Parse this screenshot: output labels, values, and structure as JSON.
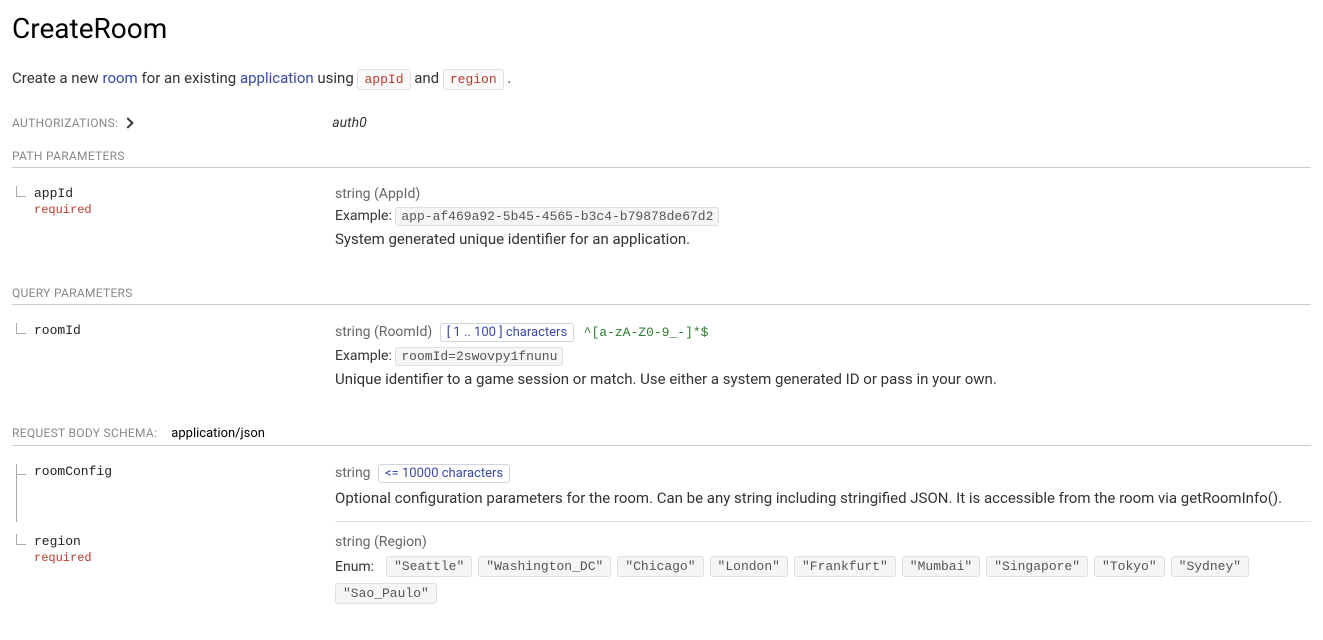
{
  "title": "CreateRoom",
  "description": {
    "pre": "Create a new ",
    "link1": "room",
    "mid1": " for an existing ",
    "link2": "application",
    "mid2": " using ",
    "code1": "appId",
    "mid3": " and ",
    "code2": "region",
    "post": " ."
  },
  "authorizations": {
    "label": "AUTHORIZATIONS:",
    "value": "auth0"
  },
  "sections": {
    "path": "PATH PARAMETERS",
    "query": "QUERY PARAMETERS",
    "body": "REQUEST BODY SCHEMA:",
    "contentType": "application/json"
  },
  "labels": {
    "required": "required",
    "example": "Example:",
    "enum": "Enum:"
  },
  "pathParams": {
    "appId": {
      "name": "appId",
      "type": "string (AppId)",
      "example": "app-af469a92-5b45-4565-b3c4-b79878de67d2",
      "desc": "System generated unique identifier for an application."
    }
  },
  "queryParams": {
    "roomId": {
      "name": "roomId",
      "type": "string (RoomId)",
      "constraint": "[ 1 .. 100 ] characters",
      "pattern": "^[a-zA-Z0-9_-]*$",
      "example": "roomId=2swovpy1fnunu",
      "desc": "Unique identifier to a game session or match. Use either a system generated ID or pass in your own."
    }
  },
  "bodyParams": {
    "roomConfig": {
      "name": "roomConfig",
      "type": "string",
      "constraint": "<= 10000 characters",
      "desc": "Optional configuration parameters for the room. Can be any string including stringified JSON. It is accessible from the room via getRoomInfo()."
    },
    "region": {
      "name": "region",
      "type": "string (Region)",
      "enum": [
        "\"Seattle\"",
        "\"Washington_DC\"",
        "\"Chicago\"",
        "\"London\"",
        "\"Frankfurt\"",
        "\"Mumbai\"",
        "\"Singapore\"",
        "\"Tokyo\"",
        "\"Sydney\"",
        "\"Sao_Paulo\""
      ]
    }
  }
}
